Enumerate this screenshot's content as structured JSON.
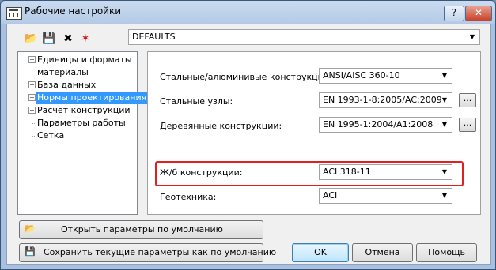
{
  "window": {
    "title": "Рабочие настройки",
    "help_label": "?",
    "close_label": "✕"
  },
  "toolbar": {
    "tools": [
      {
        "name": "open-folder-icon",
        "glyph": "📂"
      },
      {
        "name": "save-icon",
        "glyph": "💾"
      },
      {
        "name": "delete-icon",
        "glyph": "✖"
      },
      {
        "name": "delete-all-icon",
        "glyph": "✶"
      }
    ],
    "profile_value": "DEFAULTS"
  },
  "tree": {
    "items": [
      {
        "label": "Единицы и форматы",
        "expandable": true,
        "selected": false
      },
      {
        "label": "материалы",
        "expandable": false,
        "selected": false
      },
      {
        "label": "База данных",
        "expandable": true,
        "selected": false
      },
      {
        "label": "Нормы проектирования",
        "expandable": true,
        "selected": true
      },
      {
        "label": "Расчет конструкции",
        "expandable": true,
        "selected": false
      },
      {
        "label": "Параметры работы",
        "expandable": false,
        "selected": false
      },
      {
        "label": "Сетка",
        "expandable": false,
        "selected": false
      }
    ]
  },
  "codes": {
    "rows": [
      {
        "label": "Стальные/алюминивые конструкции:",
        "value": "ANSI/AISC 360-10",
        "has_more": false
      },
      {
        "label": "Стальные узлы:",
        "value": "EN 1993-1-8:2005/AC:2009",
        "has_more": true
      },
      {
        "label": "Деревянные конструкции:",
        "value": "EN 1995-1:2004/A1:2008",
        "has_more": true
      },
      {
        "label": "Ж/б конструкции:",
        "value": "ACI 318-11",
        "has_more": false
      },
      {
        "label": "Геотехника:",
        "value": "ACI",
        "has_more": false
      }
    ],
    "more_label": "...",
    "highlight_color": "#e02020"
  },
  "buttons": {
    "open_defaults": "Открыть параметры по умолчанию",
    "save_defaults": "Сохранить текущие параметры как по умолчанию",
    "ok": "OK",
    "cancel": "Отмена",
    "help": "Помощь"
  }
}
